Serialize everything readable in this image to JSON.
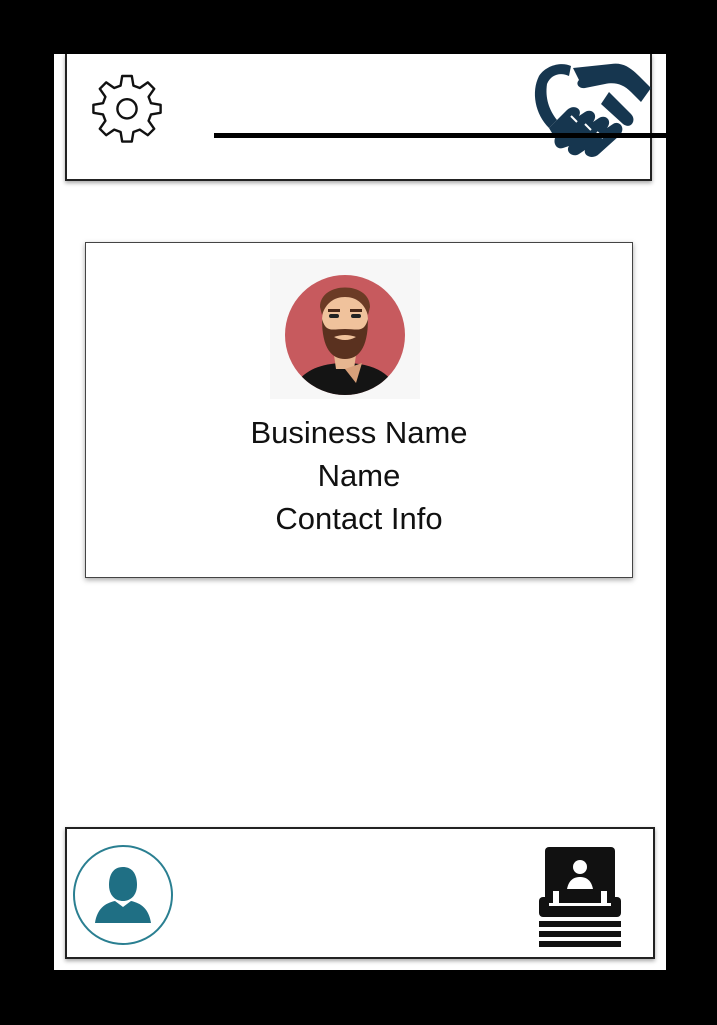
{
  "card": {
    "business_name": "Business Name",
    "name": "Name",
    "contact_info": "Contact Info"
  },
  "icons": {
    "top_left": "gear-icon",
    "top_right": "handshake-icon",
    "bottom_left": "user-profile-icon",
    "bottom_right": "contact-card-icon"
  },
  "colors": {
    "handshake": "#16364f",
    "profile_accent": "#2a7f91",
    "avatar_background": "#c75a5e"
  }
}
